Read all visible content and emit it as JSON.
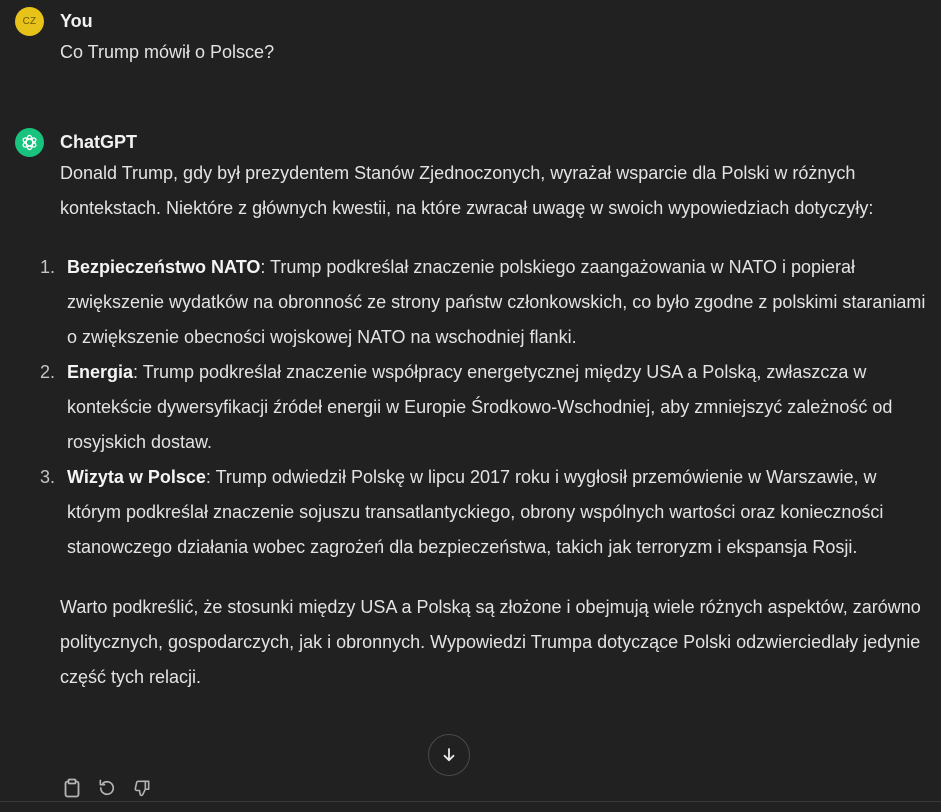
{
  "user_message": {
    "avatar_initials": "CZ",
    "author": "You",
    "text": "Co Trump mówił o Polsce?"
  },
  "assistant_message": {
    "avatar_icon": "openai-logo-icon",
    "author": "ChatGPT",
    "intro": "Donald Trump, gdy był prezydentem Stanów Zjednoczonych, wyrażał wsparcie dla Polski w różnych kontekstach. Niektóre z głównych kwestii, na które zwracał uwagę w swoich wypowiedziach dotyczyły:",
    "items": [
      {
        "number": "1.",
        "title": "Bezpieczeństwo NATO",
        "text": ": Trump podkreślał znaczenie polskiego zaangażowania w NATO i popierał zwiększenie wydatków na obronność ze strony państw członkowskich, co było zgodne z polskimi staraniami o zwiększenie obecności wojskowej NATO na wschodniej flanki."
      },
      {
        "number": "2.",
        "title": "Energia",
        "text": ": Trump podkreślał znaczenie współpracy energetycznej między USA a Polską, zwłaszcza w kontekście dywersyfikacji źródeł energii w Europie Środkowo-Wschodniej, aby zmniejszyć zależność od rosyjskich dostaw."
      },
      {
        "number": "3.",
        "title": "Wizyta w Polsce",
        "text": ": Trump odwiedził Polskę w lipcu 2017 roku i wygłosił przemówienie w Warszawie, w którym podkreślał znaczenie sojuszu transatlantyckiego, obrony wspólnych wartości oraz konieczności stanowczego działania wobec zagrożeń dla bezpieczeństwa, takich jak terroryzm i ekspansja Rosji."
      }
    ],
    "outro": "Warto podkreślić, że stosunki między USA a Polską są złożone i obejmują wiele różnych aspektów, zarówno politycznych, gospodarczych, jak i obronnych. Wypowiedzi Trumpa dotyczące Polski odzwierciedlały jedynie część tych relacji."
  },
  "actions": {
    "copy_icon": "clipboard-icon",
    "regenerate_icon": "regenerate-icon",
    "dislike_icon": "thumbs-down-icon",
    "scroll_icon": "arrow-down-icon"
  },
  "colors": {
    "background": "#212121",
    "text": "#e3e3e3",
    "user_avatar": "#e7c31a",
    "assistant_avatar": "#19c37d"
  }
}
